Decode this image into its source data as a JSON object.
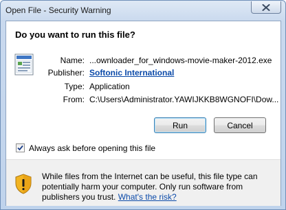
{
  "window": {
    "title": "Open File - Security Warning",
    "close_icon": "close-x-icon"
  },
  "dialog": {
    "heading": "Do you want to run this file?",
    "file_icon": "executable-file-icon",
    "fields": {
      "name_label": "Name:",
      "name_value": "...ownloader_for_windows-movie-maker-2012.exe",
      "publisher_label": "Publisher:",
      "publisher_value": "Softonic International",
      "type_label": "Type:",
      "type_value": "Application",
      "from_label": "From:",
      "from_value": "C:\\Users\\Administrator.YAWIJKKB8WGNOFI\\Dow..."
    },
    "buttons": {
      "run": "Run",
      "cancel": "Cancel"
    },
    "checkbox": {
      "label": "Always ask before opening this file",
      "checked": true
    },
    "warning": {
      "icon": "shield-warning-icon",
      "text": "While files from the Internet can be useful, this file type can potentially harm your computer. Only run software from publishers you trust.",
      "link": "What's the risk?"
    }
  }
}
